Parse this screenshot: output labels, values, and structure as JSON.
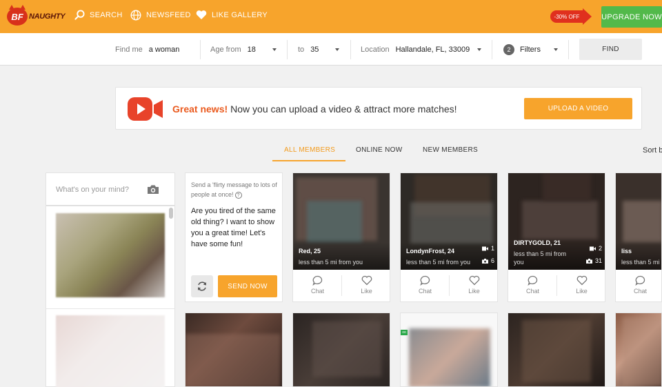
{
  "header": {
    "logo_text": "NAUGHTY",
    "logo_badge": "BF",
    "nav": [
      {
        "label": "SEARCH",
        "icon": "search-icon"
      },
      {
        "label": "NEWSFEED",
        "icon": "globe-icon"
      },
      {
        "label": "LIKE GALLERY",
        "icon": "heart-icon"
      }
    ],
    "discount_label": "-30% OFF",
    "upgrade_label": "UPGRADE NOW",
    "colors": {
      "bar": "#f7a42c",
      "upgrade": "#52b94a",
      "discount": "#e0301e"
    }
  },
  "search": {
    "find_me_label": "Find me",
    "find_me_value": "a woman",
    "age_from_label": "Age from",
    "age_from_value": "18",
    "age_to_label": "to",
    "age_to_value": "35",
    "location_label": "Location",
    "location_value": "Hallandale, FL, 33009",
    "filters_count": "2",
    "filters_label": "Filters",
    "find_label": "FIND"
  },
  "banner": {
    "icon": "video-camera-icon",
    "highlight": "Great news!",
    "text": "Now you can upload a video & attract more matches!",
    "button_label": "UPLOAD A VIDEO"
  },
  "tabs": [
    {
      "label": "ALL MEMBERS",
      "active": true
    },
    {
      "label": "ONLINE NOW",
      "active": false
    },
    {
      "label": "NEW MEMBERS",
      "active": false
    }
  ],
  "sort_label": "Sort b",
  "mind": {
    "placeholder": "What's on your mind?",
    "icon": "camera-icon"
  },
  "flirt": {
    "hint": "Send a 'flirty message to lots of people at once!",
    "message": "Are you tired of the same old thing? I want to show you a great time! Let's have some fun!",
    "refresh_icon": "refresh-icon",
    "send_label": "SEND NOW"
  },
  "members": [
    {
      "name": "Red, 25",
      "distance": "less than 5 mi from you",
      "videos": "",
      "photos": "",
      "chat_label": "Chat",
      "like_label": "Like"
    },
    {
      "name": "LondynFrost, 24",
      "distance": "less than 5 mi from you",
      "videos": "1",
      "photos": "6",
      "chat_label": "Chat",
      "like_label": "Like"
    },
    {
      "name": "DIRTYGOLD, 21",
      "distance": "less than 5 mi from you",
      "videos": "2",
      "photos": "31",
      "chat_label": "Chat",
      "like_label": "Like"
    },
    {
      "name": "liss",
      "distance": "less than 5 mi",
      "videos": "",
      "photos": "",
      "chat_label": "Chat",
      "like_label": ""
    }
  ],
  "online_badge": "oo"
}
